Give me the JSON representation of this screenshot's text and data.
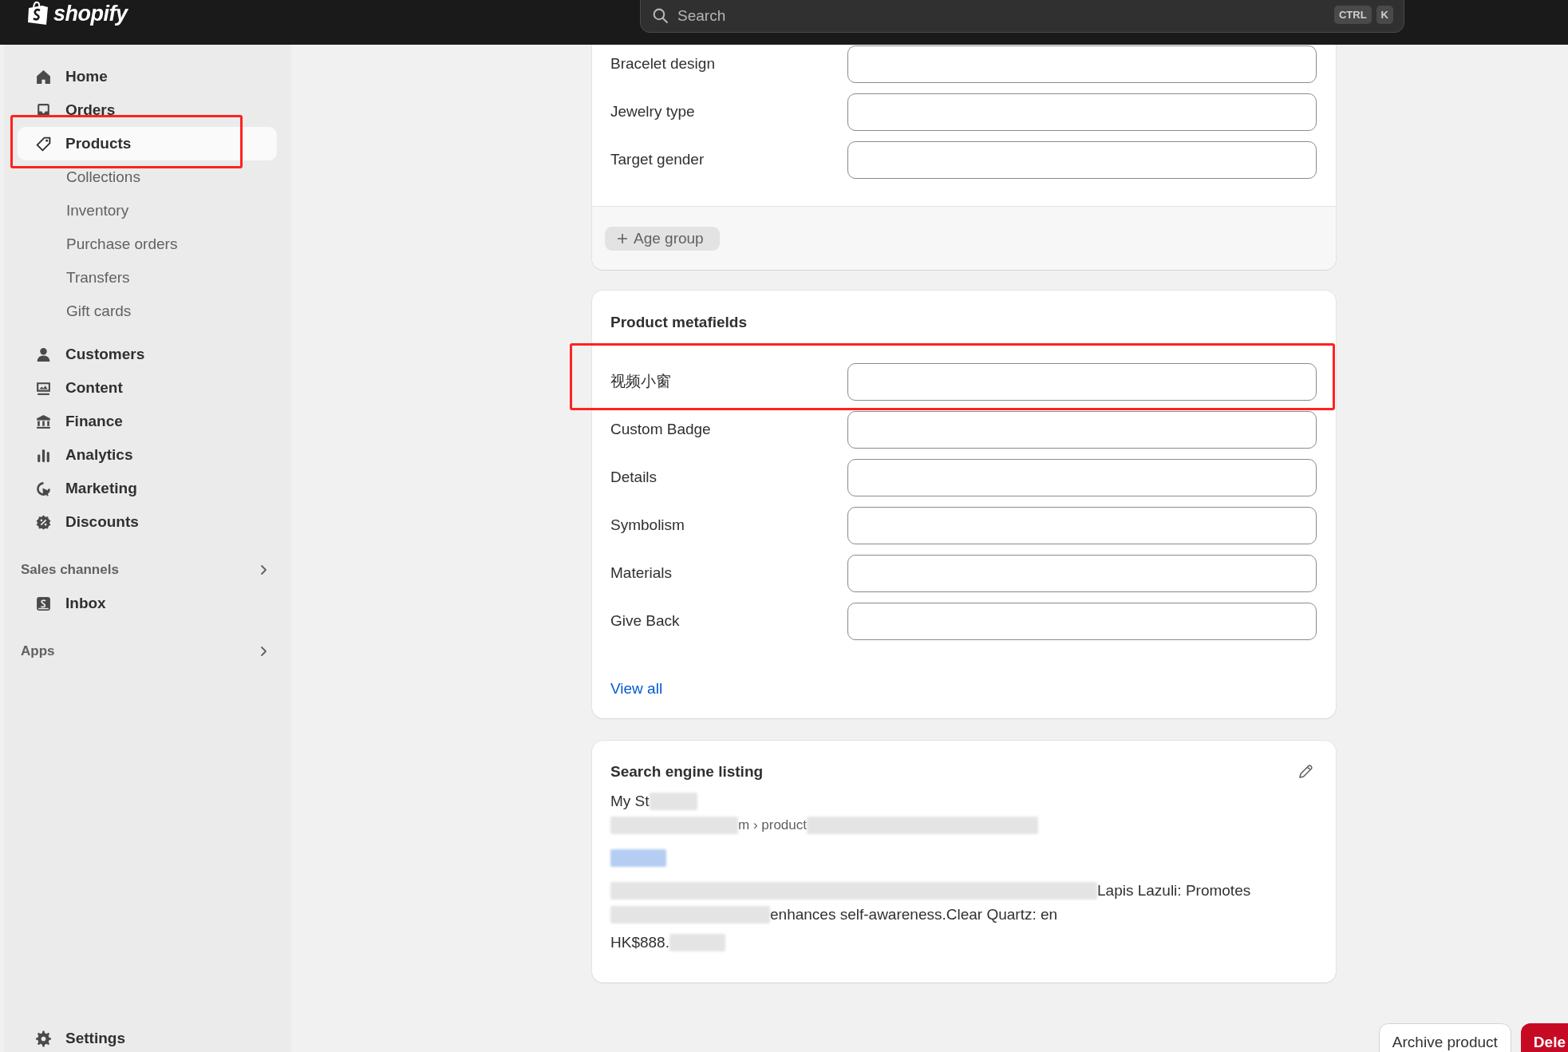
{
  "topbar": {
    "logo": "shopify",
    "search": {
      "placeholder": "Search"
    },
    "shortcut_keys": [
      "CTRL",
      "K"
    ]
  },
  "sidebar": {
    "items": [
      {
        "label": "Home",
        "selected": false
      },
      {
        "label": "Orders",
        "selected": false
      },
      {
        "label": "Products",
        "selected": true,
        "children": [
          {
            "label": "Collections",
            "selected": false
          },
          {
            "label": "Inventory",
            "selected": false
          },
          {
            "label": "Purchase orders",
            "selected": false
          },
          {
            "label": "Transfers",
            "selected": false
          },
          {
            "label": "Gift cards",
            "selected": false
          }
        ]
      },
      {
        "label": "Customers",
        "selected": false
      },
      {
        "label": "Content",
        "selected": false
      },
      {
        "label": "Finance",
        "selected": false
      },
      {
        "label": "Analytics",
        "selected": false
      },
      {
        "label": "Marketing",
        "selected": false
      },
      {
        "label": "Discounts",
        "selected": false
      }
    ],
    "sections": [
      {
        "title": "Sales channels",
        "items": [
          {
            "label": "Inbox",
            "selected": false
          }
        ]
      },
      {
        "title": "Apps"
      }
    ],
    "settings": "Settings"
  },
  "attributes_card": {
    "fields": [
      {
        "label": "Bracelet design"
      },
      {
        "label": "Jewelry type"
      },
      {
        "label": "Target gender"
      }
    ],
    "add_button": "Age group"
  },
  "metafields_card": {
    "title": "Product metafields",
    "fields": [
      {
        "label": "视频小窗"
      },
      {
        "label": "Custom Badge"
      },
      {
        "label": "Details"
      },
      {
        "label": "Symbolism"
      },
      {
        "label": "Materials"
      },
      {
        "label": "Give Back"
      }
    ],
    "link": "View all"
  },
  "seo_card": {
    "title": "Search engine listing",
    "store": "My St",
    "url": "m › product",
    "description": [
      "Lapis Lazuli: Promotes",
      "enhances self-awareness.Clear Quartz: en"
    ],
    "price": "HK$888."
  },
  "actions": [
    {
      "label": "Archive product",
      "kind": "secondary"
    },
    {
      "label": "Dele",
      "kind": "destructive"
    }
  ]
}
